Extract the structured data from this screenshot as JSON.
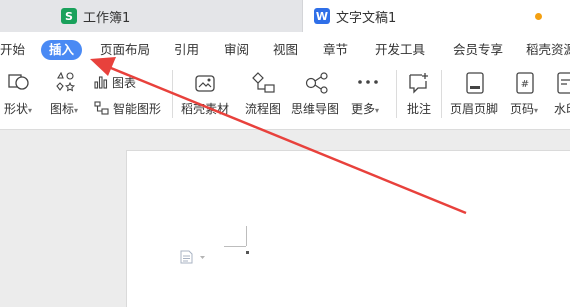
{
  "tabs": [
    {
      "title": "工作簿1",
      "icon": "spreadsheet-icon",
      "icon_letter": "S",
      "color": "#19a15b"
    },
    {
      "title": "文字文稿1",
      "icon": "document-icon",
      "icon_letter": "W",
      "color": "#2f6fe8"
    }
  ],
  "menu": {
    "start": "开始",
    "insert": "插入",
    "layout": "页面布局",
    "references": "引用",
    "review": "审阅",
    "view": "视图",
    "section": "章节",
    "dev": "开发工具",
    "member": "会员专享",
    "resources": "稻壳资源"
  },
  "toolbar": {
    "shapes": "形状",
    "icons": "图标",
    "chart": "图表",
    "smart_graphic": "智能图形",
    "docer_material": "稻壳素材",
    "flowchart": "流程图",
    "mindmap": "思维导图",
    "more": "更多",
    "comment": "批注",
    "header_footer": "页眉页脚",
    "page_number": "页码",
    "watermark": "水印"
  },
  "colors": {
    "accent": "#4a8af4",
    "annotation_arrow": "#e8413c",
    "unsaved_dot": "#f4a011"
  }
}
